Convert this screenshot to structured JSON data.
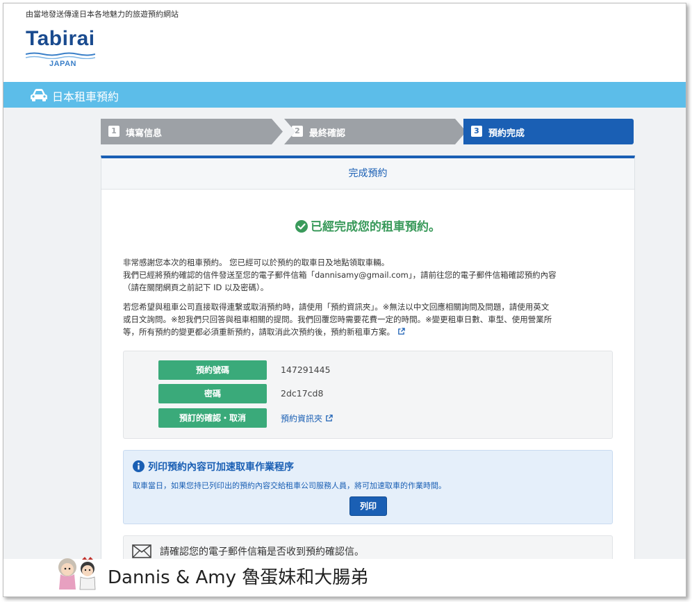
{
  "header": {
    "tagline": "由當地發送傳達日本各地魅力的旅遊預約網站",
    "logo_word": "Tabirai",
    "logo_sub": "JAPAN"
  },
  "bar": {
    "title": "日本租車預約",
    "icon": "car-icon"
  },
  "steps": [
    {
      "num": "1",
      "label": "填寫信息",
      "state": "done"
    },
    {
      "num": "2",
      "label": "最終確認",
      "state": "done"
    },
    {
      "num": "3",
      "label": "預約完成",
      "state": "active"
    }
  ],
  "panel": {
    "title": "完成預約",
    "done_message": "已經完成您的租車預約。",
    "para1": [
      "非常感謝您本次的租車預約。 您已經可以於預約的取車日及地點領取車輛。",
      "我們已經將預約確認的信件發送至您的電子郵件信箱「dannisamy@gmail.com」，請前往您的電子郵件信箱確認預約內容",
      "（請在關閉網頁之前記下 ID 以及密碼）。"
    ],
    "para2": [
      "若您希望與租車公司直接取得連繫或取消預約時，請使用「預約資訊夾」。※無法以中文回應相關詢問及問題，請使用英文",
      "或日文詢問。※恕我們只回答與租車相關的提問。我們回覆您時需要花費一定的時間。※變更租車日數、車型、使用營業所",
      "等，所有預約的變更都必須重新預約，請取消此次預約後，預約新租車方案。"
    ],
    "booking": {
      "number_label": "預約號碼",
      "number": "147291445",
      "password_label": "密碼",
      "password": "2dc17cd8",
      "confirm_label": "預訂的確認・取消",
      "confirm_link": "預約資訊夾"
    },
    "print": {
      "title": "列印預約內容可加速取車作業程序",
      "text": "取車當日，如果您持已列印出的預約內容交給租車公司服務人員，將可加速取車的作業時間。",
      "button": "列印"
    },
    "mail": {
      "text": "請確認您的電子郵件信箱是否收到預約確認信。"
    }
  },
  "watermark": {
    "text": "Dannis & Amy 魯蛋妹和大腸弟"
  },
  "colors": {
    "accent": "#1a5fb4",
    "bar": "#5cbde9",
    "green": "#3aaa7a",
    "step_inactive": "#9da1a6"
  }
}
